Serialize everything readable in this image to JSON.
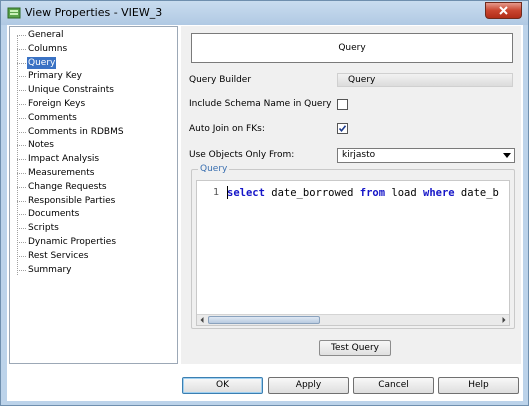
{
  "window": {
    "title": "View Properties - VIEW_3"
  },
  "nav": {
    "items": [
      {
        "label": "General",
        "selected": false
      },
      {
        "label": "Columns",
        "selected": false
      },
      {
        "label": "Query",
        "selected": true
      },
      {
        "label": "Primary Key",
        "selected": false
      },
      {
        "label": "Unique Constraints",
        "selected": false
      },
      {
        "label": "Foreign Keys",
        "selected": false
      },
      {
        "label": "Comments",
        "selected": false
      },
      {
        "label": "Comments in RDBMS",
        "selected": false
      },
      {
        "label": "Notes",
        "selected": false
      },
      {
        "label": "Impact Analysis",
        "selected": false
      },
      {
        "label": "Measurements",
        "selected": false
      },
      {
        "label": "Change Requests",
        "selected": false
      },
      {
        "label": "Responsible Parties",
        "selected": false
      },
      {
        "label": "Documents",
        "selected": false
      },
      {
        "label": "Scripts",
        "selected": false
      },
      {
        "label": "Dynamic Properties",
        "selected": false
      },
      {
        "label": "Rest Services",
        "selected": false
      },
      {
        "label": "Summary",
        "selected": false
      }
    ]
  },
  "panel": {
    "header": "Query",
    "query_builder": {
      "label": "Query Builder",
      "button": "Query"
    },
    "include_schema": {
      "label": "Include Schema Name in Query",
      "checked": false
    },
    "auto_join": {
      "label": "Auto Join on FKs:",
      "checked": true
    },
    "use_objects": {
      "label": "Use Objects Only From:",
      "value": "kirjasto"
    },
    "query_group": {
      "legend": "Query",
      "line_number": "1",
      "code_tokens": [
        {
          "text": "select",
          "kw": true
        },
        {
          "text": " date_borrowed ",
          "kw": false
        },
        {
          "text": "from",
          "kw": true
        },
        {
          "text": " load ",
          "kw": false
        },
        {
          "text": "where",
          "kw": true
        },
        {
          "text": " date_b",
          "kw": false
        }
      ]
    },
    "test_query": "Test Query"
  },
  "buttons": {
    "ok": "OK",
    "apply": "Apply",
    "cancel": "Cancel",
    "help": "Help"
  },
  "colors": {
    "selection": "#3a72c4",
    "keyword": "#1515c8",
    "legend": "#3a6fb0"
  }
}
